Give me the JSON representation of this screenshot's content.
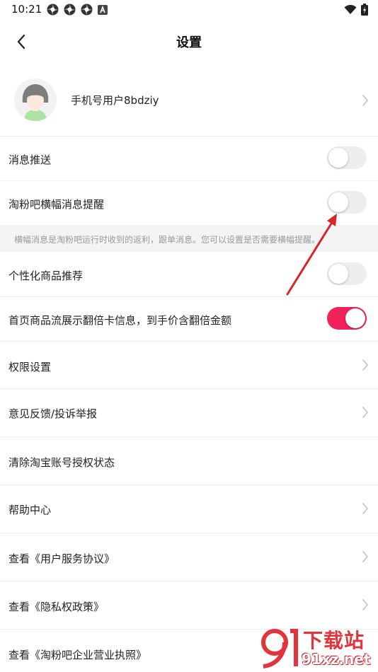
{
  "status_bar": {
    "time": "10:21"
  },
  "header": {
    "title": "设置"
  },
  "profile": {
    "name": "手机号用户8bdziy"
  },
  "settings": {
    "message_push": {
      "label": "消息推送",
      "enabled": false
    },
    "banner_reminder": {
      "label": "淘粉吧横幅消息提醒",
      "enabled": false
    },
    "banner_hint": "横幅消息是淘粉吧运行时收到的返利，跟单消息。您可以设置是否需要横幅提醒。",
    "personalized": {
      "label": "个性化商品推荐",
      "enabled": false
    },
    "double_card": {
      "label": "首页商品流展示翻倍卡信息，到手价含翻倍金额",
      "enabled": true
    },
    "permissions": {
      "label": "权限设置"
    },
    "feedback": {
      "label": "意见反馈/投诉举报"
    },
    "clear_auth": {
      "label": "清除淘宝账号授权状态"
    },
    "help": {
      "label": "帮助中心"
    },
    "user_agreement": {
      "label": "查看《用户服务协议》"
    },
    "privacy": {
      "label": "查看《隐私权政策》"
    },
    "license": {
      "label": "查看《淘粉吧企业营业执照》"
    }
  },
  "colors": {
    "accent": "#f0225a",
    "annotation_arrow": "#d9232a"
  },
  "watermark": {
    "brand": "下载站",
    "domain": "91xz.net"
  }
}
